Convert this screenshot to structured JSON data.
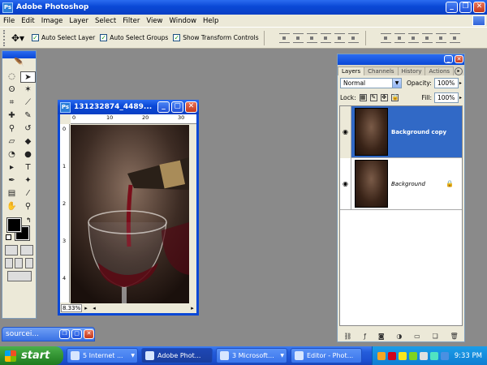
{
  "app": {
    "title": "Adobe Photoshop"
  },
  "menu": [
    "File",
    "Edit",
    "Image",
    "Layer",
    "Select",
    "Filter",
    "View",
    "Window",
    "Help"
  ],
  "options": {
    "auto_select_layer": "Auto Select Layer",
    "auto_select_groups": "Auto Select Groups",
    "show_transform_controls": "Show Transform Controls"
  },
  "document": {
    "title": "131232874_4489...",
    "zoom": "8.33%",
    "ruler_h": [
      "0",
      "10",
      "20",
      "30"
    ],
    "ruler_v": [
      "0",
      "1",
      "2",
      "3",
      "4"
    ]
  },
  "layers_panel": {
    "tabs": [
      "Layers",
      "Channels",
      "History",
      "Actions"
    ],
    "blend_mode": "Normal",
    "opacity_label": "Opacity:",
    "opacity": "100%",
    "lock_label": "Lock:",
    "fill_label": "Fill:",
    "fill": "100%",
    "layers": [
      {
        "name": "Background copy",
        "selected": true
      },
      {
        "name": "Background",
        "selected": false
      }
    ]
  },
  "minimized_doc": {
    "title": "sourcei..."
  },
  "taskbar": {
    "start": "start",
    "tasks": [
      "5 Internet ...",
      "Adobe Phot...",
      "3 Microsoft...",
      "Editor - Phot..."
    ],
    "clock": "9:33 PM"
  },
  "colors": {
    "xp_blue": "#0a48d6",
    "selected_layer": "#3169c6",
    "start_green": "#2f8f2f"
  }
}
